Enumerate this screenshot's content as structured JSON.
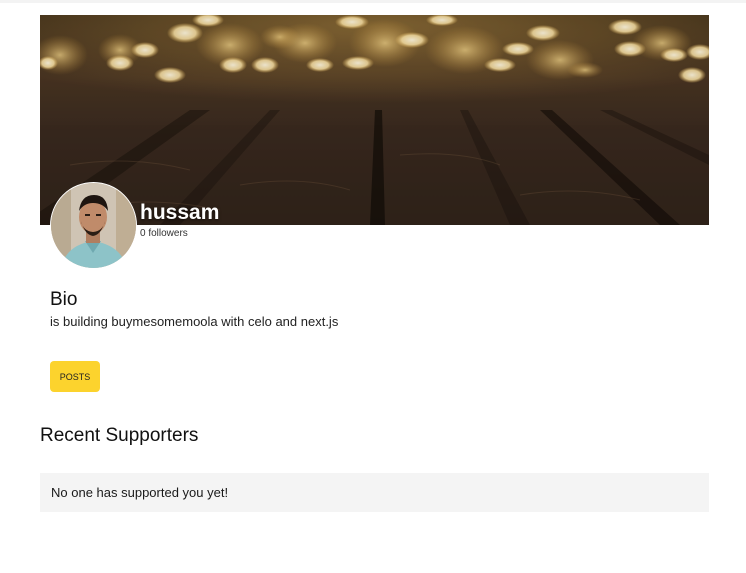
{
  "profile": {
    "username": "hussam",
    "followers": "0 followers"
  },
  "bio": {
    "heading": "Bio",
    "text": "is building buymesomemoola with celo and next.js"
  },
  "buttons": {
    "posts_label": "Posts"
  },
  "supporters": {
    "heading": "Recent Supporters",
    "empty_message": "No one has supported you yet!"
  },
  "colors": {
    "accent_button": "#fcd32d",
    "empty_state_bg": "#f4f4f4"
  }
}
